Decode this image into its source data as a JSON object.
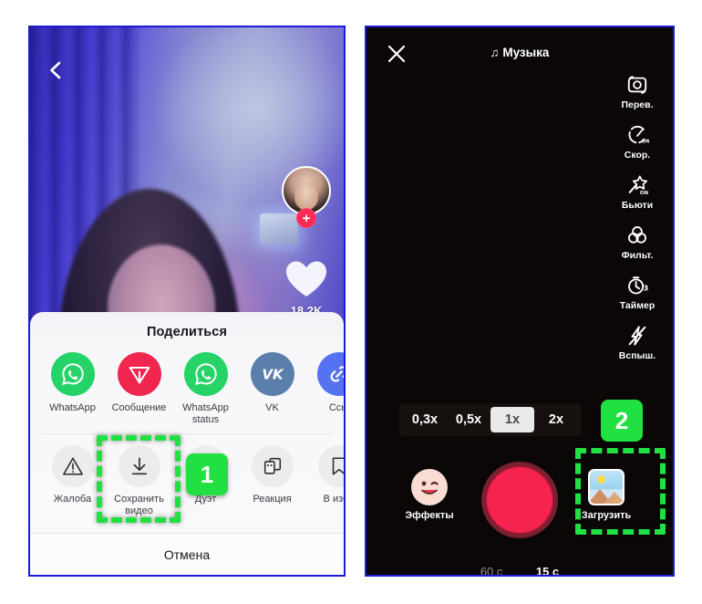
{
  "left_panel": {
    "name": "tiktok-video-share-screen",
    "back_icon": "chevron-left-icon",
    "video": {
      "avatar_icon": "user-avatar",
      "follow_icon": "plus-icon",
      "like_icon": "heart-icon",
      "like_count": "18,2K"
    },
    "share_sheet": {
      "title": "Поделиться",
      "row1": [
        {
          "label": "WhatsApp",
          "icon": "whatsapp-icon",
          "color": "#25d366"
        },
        {
          "label": "Сообщение",
          "icon": "direct-send-icon",
          "color": "#f0264f"
        },
        {
          "label": "WhatsApp status",
          "icon": "whatsapp-icon",
          "color": "#25d366"
        },
        {
          "label": "VK",
          "icon": "vk-icon",
          "color": "#5a7fab"
        },
        {
          "label": "Ссы",
          "icon": "link-icon",
          "color": "#5572f0"
        }
      ],
      "row2": [
        {
          "label": "Жалоба",
          "icon": "warning-triangle-icon"
        },
        {
          "label": "Сохранить видео",
          "icon": "download-icon"
        },
        {
          "label": "Дуэт",
          "icon": "duet-icon"
        },
        {
          "label": "Реакция",
          "icon": "reaction-icon"
        },
        {
          "label": "В избр",
          "icon": "bookmark-icon"
        }
      ],
      "cancel_label": "Отмена"
    }
  },
  "right_panel": {
    "name": "tiktok-camera-screen",
    "close_icon": "close-x-icon",
    "music": {
      "note_icon": "music-note-icon",
      "label": "Музыка"
    },
    "tools": [
      {
        "label": "Перев.",
        "icon": "flip-camera-icon"
      },
      {
        "label": "Скор.",
        "icon": "speed-icon",
        "state": "ON"
      },
      {
        "label": "Бьюти",
        "icon": "beauty-wand-icon",
        "state": "ON"
      },
      {
        "label": "Фильт.",
        "icon": "filters-icon"
      },
      {
        "label": "Таймер",
        "icon": "timer-icon",
        "value": "3"
      },
      {
        "label": "Вспыш.",
        "icon": "flash-off-icon"
      }
    ],
    "zoom_levels": [
      {
        "label": "0,3x",
        "active": false
      },
      {
        "label": "0,5x",
        "active": false
      },
      {
        "label": "1x",
        "active": true
      },
      {
        "label": "2x",
        "active": false
      }
    ],
    "effects": {
      "label": "Эффекты",
      "icon": "smiley-wink-icon"
    },
    "shutter": {
      "icon": "record-button",
      "color": "#f5244f"
    },
    "upload": {
      "label": "Загрузить",
      "icon": "photo-gallery-icon"
    },
    "durations": [
      {
        "label": "60 c",
        "active": false
      },
      {
        "label": "15 c",
        "active": true
      }
    ]
  },
  "annotations": {
    "badge_1": "1",
    "badge_2": "2",
    "highlight_color": "#21e041"
  }
}
